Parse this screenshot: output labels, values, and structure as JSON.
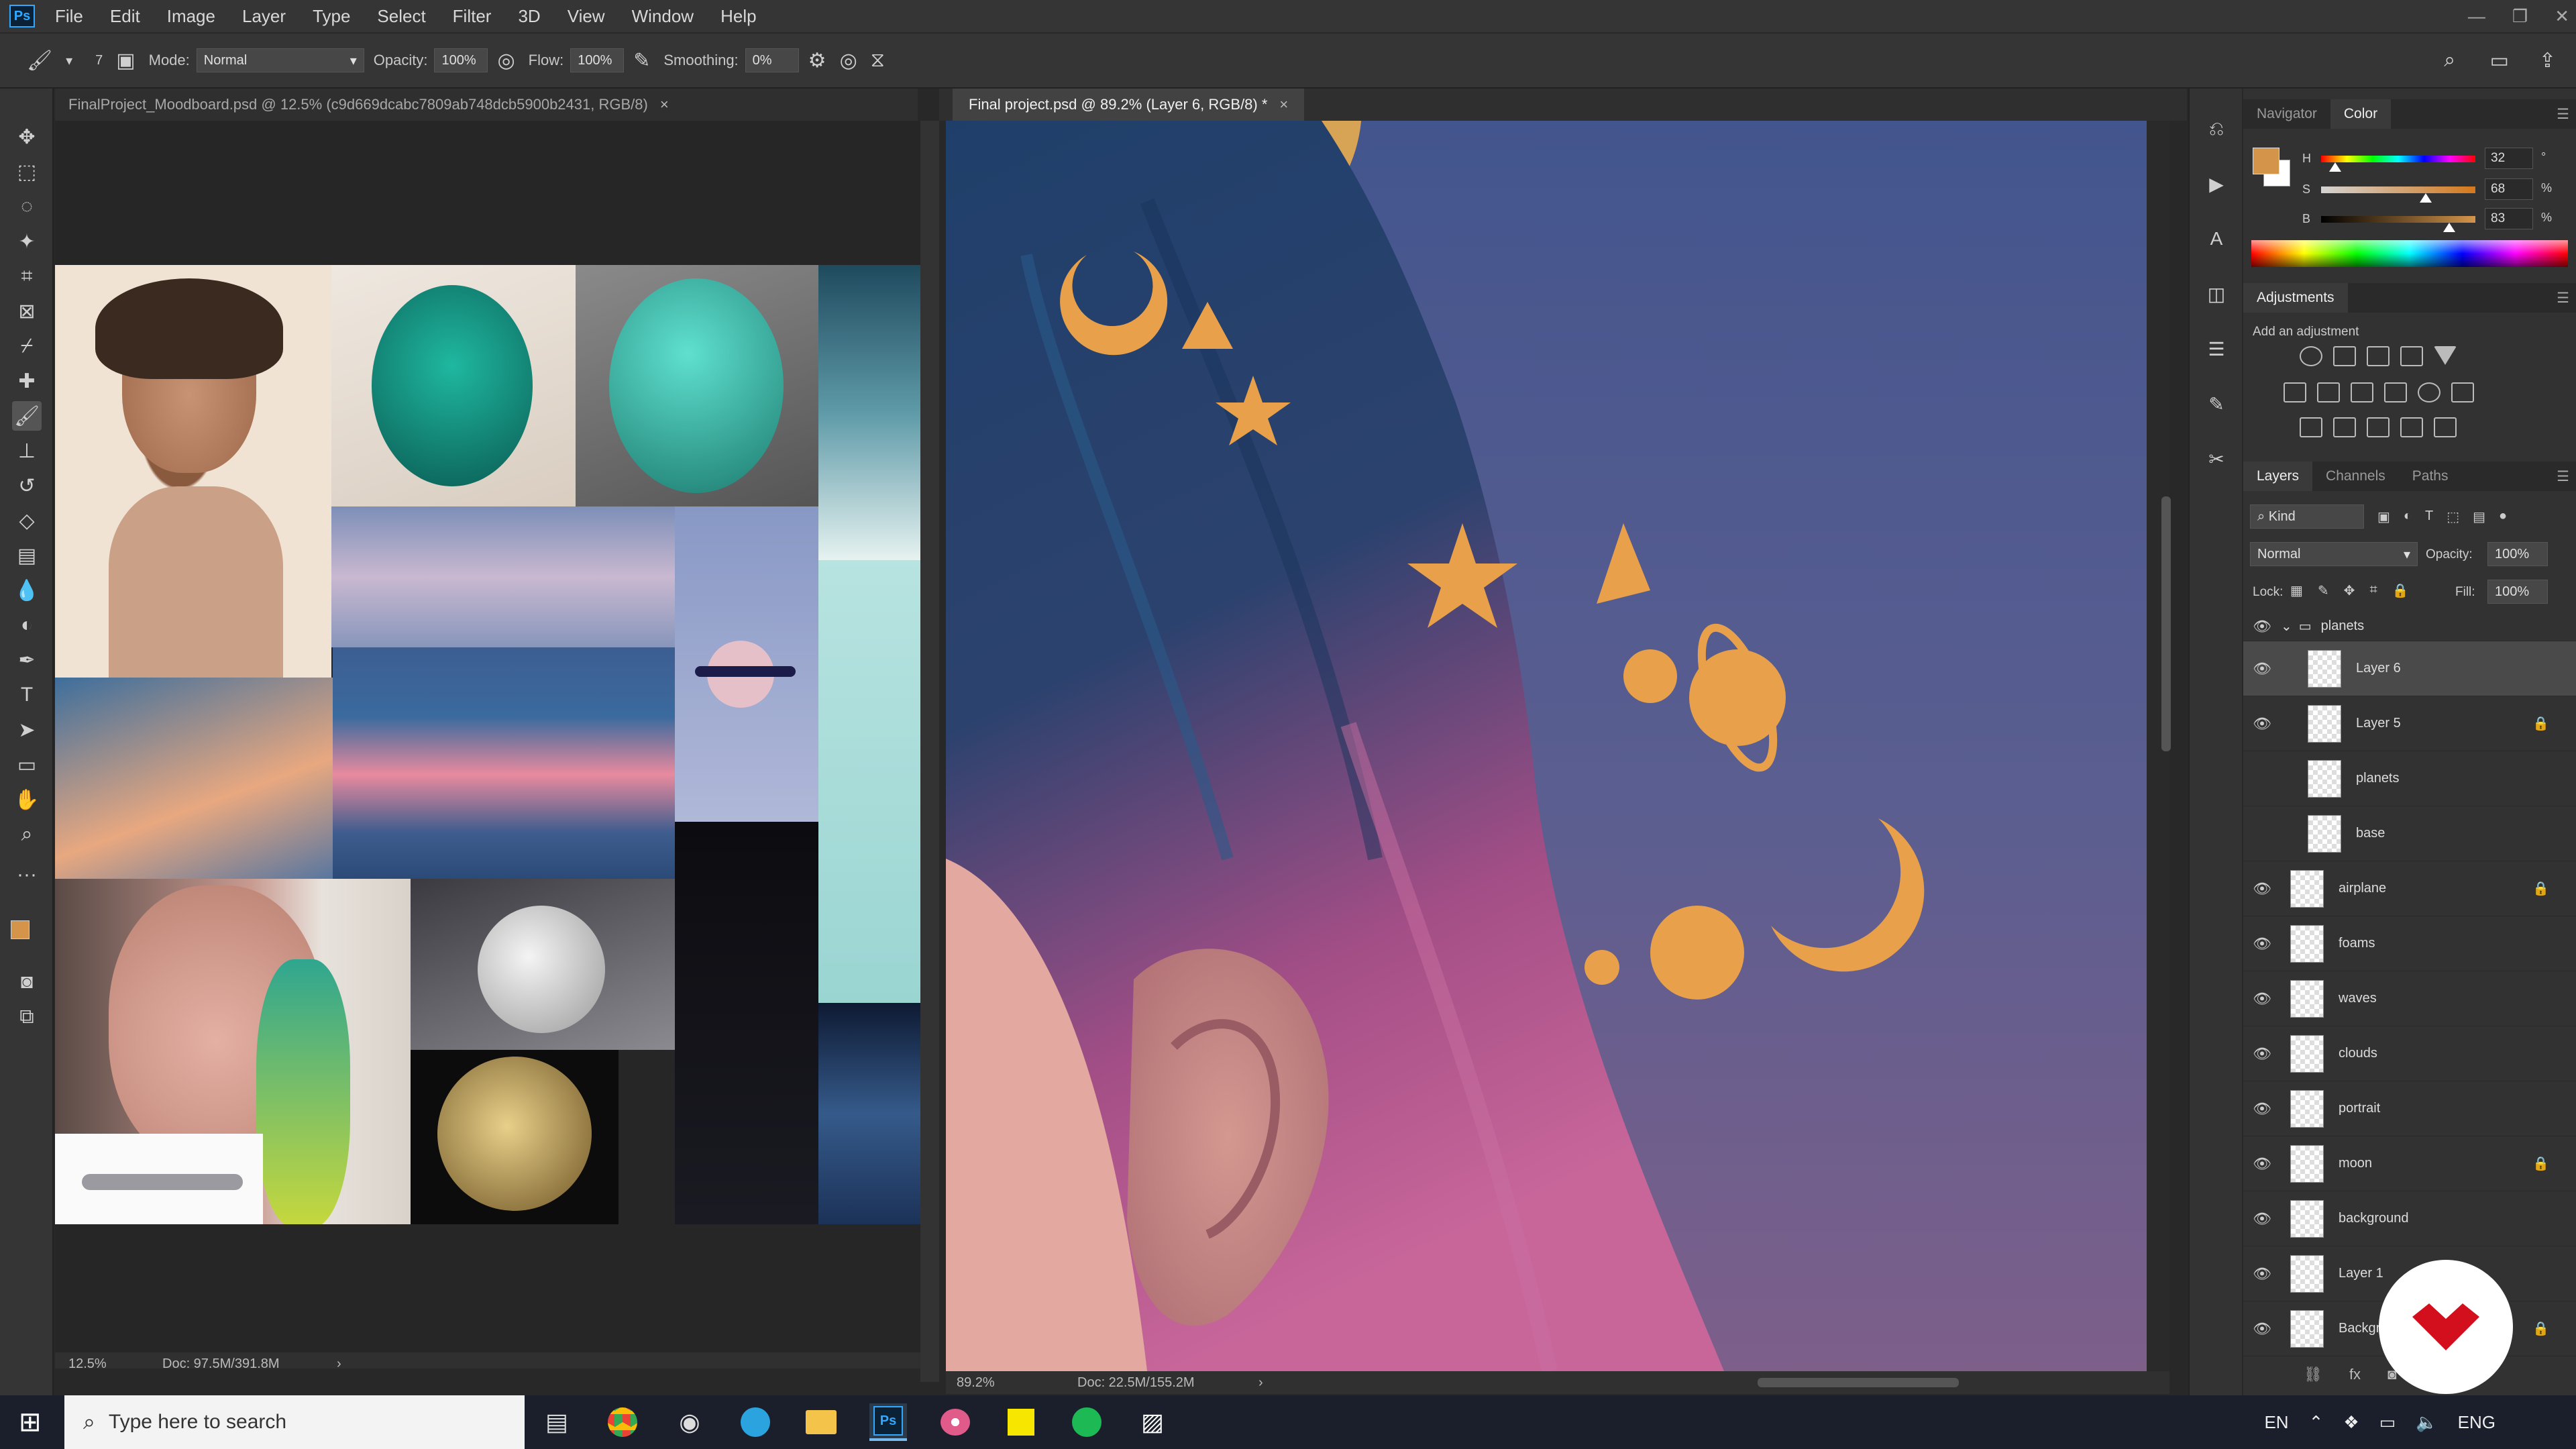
{
  "app": {
    "logo": "Ps"
  },
  "menu": [
    "File",
    "Edit",
    "Image",
    "Layer",
    "Type",
    "Select",
    "Filter",
    "3D",
    "View",
    "Window",
    "Help"
  ],
  "window_controls": [
    "—",
    "❐",
    "✕"
  ],
  "options": {
    "brush_size": "7",
    "mode_label": "Mode:",
    "mode_value": "Normal",
    "opacity_label": "Opacity:",
    "opacity_value": "100%",
    "flow_label": "Flow:",
    "flow_value": "100%",
    "smoothing_label": "Smoothing:",
    "smoothing_value": "0%"
  },
  "docs": {
    "left_tab": "FinalProject_Moodboard.psd @ 12.5% (c9d669dcabc7809ab748dcb5900b2431, RGB/8)",
    "right_tab": "Final project.psd @ 89.2% (Layer 6, RGB/8) *",
    "close": "×",
    "left_status_zoom": "12.5%",
    "left_status_doc": "Doc: 97.5M/391.8M",
    "right_status_zoom": "89.2%",
    "right_status_doc": "Doc: 22.5M/155.2M",
    "status_arrow": "›"
  },
  "color_panel": {
    "tabs": [
      "Navigator",
      "Color"
    ],
    "h_label": "H",
    "s_label": "S",
    "b_label": "B",
    "h_value": "32",
    "s_value": "68",
    "b_value": "83",
    "h_unit": "°",
    "s_unit": "%",
    "b_unit": "%",
    "h_level": 0.09,
    "s_level": 0.68,
    "b_level": 0.83,
    "fg_color": "#d4954a",
    "bg_color": "#ffffff"
  },
  "adjustments": {
    "title": "Adjustments",
    "hint": "Add an adjustment"
  },
  "layers_panel": {
    "tabs": [
      "Layers",
      "Channels",
      "Paths"
    ],
    "kind": "Kind",
    "blend": "Normal",
    "opacity_label": "Opacity:",
    "opacity_value": "100%",
    "lock_label": "Lock:",
    "fill_label": "Fill:",
    "fill_value": "100%",
    "group": "planets",
    "layers": [
      {
        "name": "Layer 6",
        "visible": true,
        "locked": false,
        "selected": true
      },
      {
        "name": "Layer 5",
        "visible": true,
        "locked": true,
        "selected": false
      },
      {
        "name": "planets",
        "visible": false,
        "locked": false,
        "selected": false
      },
      {
        "name": "base",
        "visible": false,
        "locked": false,
        "selected": false
      },
      {
        "name": "airplane",
        "visible": true,
        "locked": true,
        "selected": false
      },
      {
        "name": "foams",
        "visible": true,
        "locked": false,
        "selected": false
      },
      {
        "name": "waves",
        "visible": true,
        "locked": false,
        "selected": false
      },
      {
        "name": "clouds",
        "visible": true,
        "locked": false,
        "selected": false
      },
      {
        "name": "portrait",
        "visible": true,
        "locked": false,
        "selected": false
      },
      {
        "name": "moon",
        "visible": true,
        "locked": true,
        "selected": false
      },
      {
        "name": "background",
        "visible": true,
        "locked": false,
        "selected": false
      },
      {
        "name": "Layer 1",
        "visible": true,
        "locked": false,
        "selected": false
      },
      {
        "name": "Backgro",
        "visible": true,
        "locked": true,
        "selected": false
      }
    ],
    "footer_fx": "fx"
  },
  "taskbar": {
    "search_placeholder": "Type here to search",
    "tray_lang": "EN",
    "tray_kbd": "ENG",
    "ps_label": "Ps"
  },
  "colors": {
    "accent": "#31a8ff",
    "canvas_bg": "#4a5a88",
    "planet": "#e8a14a"
  }
}
